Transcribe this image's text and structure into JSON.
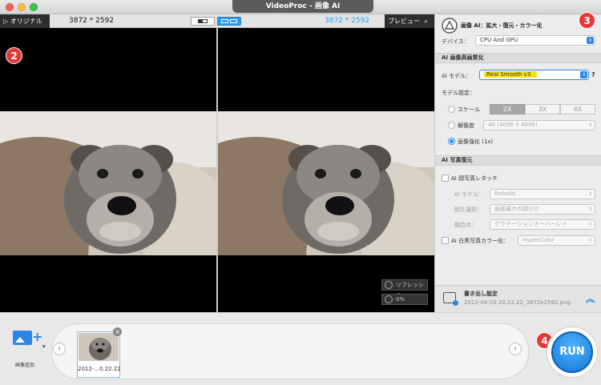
{
  "window": {
    "title": "VideoProc - 画像 AI"
  },
  "preview": {
    "original_tab": "▷ オリジナル",
    "original_resolution": "3872 * 2592",
    "output_resolution": "3872 * 2592",
    "preview_tab": "プレビュー",
    "refresh_label": "リフレッシュ",
    "progress_label": "0%",
    "step_badge": "2"
  },
  "panel": {
    "step_badge": "3",
    "title": "画像 AI：拡大・復元・カラー化",
    "device_label": "デバイス：",
    "device_value": "CPU And GPU",
    "section_enhance": "AI 画像高画質化",
    "model_label": "AI モデル：",
    "model_value": "Real Smooth v3",
    "model_help": "?",
    "model_settings_label": "モデル設定：",
    "scale_label": "スケール",
    "scale_options": [
      "2X",
      "3X",
      "4X"
    ],
    "resolution_label": "解像度",
    "resolution_value": "4K (4096 X 4096)",
    "enhance_label": "画像強化 (1x)",
    "section_restore": "AI 写真復元",
    "face_retouch_label": "AI 顔写真レタッチ",
    "face_model_label": "AI モデル：",
    "face_model_value": "Rebuild",
    "face_select_label": "顔を選択：",
    "face_select_value": "画面最大の顔だけ",
    "blend_label": "融合点：",
    "blend_value": "グラデーションオーバーレイ",
    "colorize_label": "AI 白黒写真カラー化：",
    "colorize_value": "HyperColor",
    "export_title": "書き出し設定",
    "export_path": "2012-04-10 20.22.22_3872x2592.png"
  },
  "bottom": {
    "add_label": "画像追加",
    "thumb_label": "2012-...0.22.22",
    "run_label": "RUN",
    "step_badge": "4"
  },
  "colors": {
    "accent": "#2b86e6",
    "badge": "#e53935",
    "highlight": "#f5e21a"
  }
}
